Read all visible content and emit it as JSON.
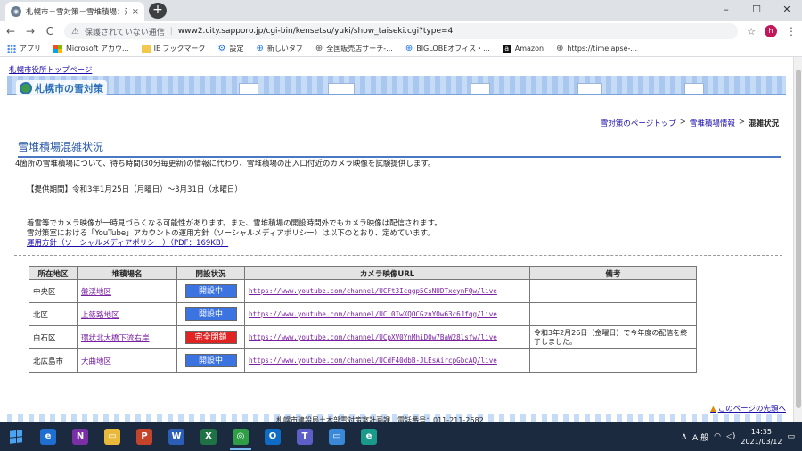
{
  "browser": {
    "tab_title": "札幌市－雪対策－雪堆積場：混雑",
    "tab_close": "×",
    "new_tab": "+",
    "win_minimize": "–",
    "win_maximize": "☐",
    "win_close": "✕",
    "back": "←",
    "forward": "→",
    "reload": "C",
    "security_label": "保護されていない通信",
    "separator": "|",
    "url": "www2.city.sapporo.jp/cgi-bin/kensetsu/yuki/show_taiseki.cgi?type=4",
    "profile_initial": "h"
  },
  "bookmarks": [
    {
      "label": "アプリ",
      "icon": "apps-grid-icon"
    },
    {
      "label": "Microsoft アカウ...",
      "icon": "microsoft-logo-icon"
    },
    {
      "label": "IE ブックマーク",
      "icon": "folder-icon"
    },
    {
      "label": "設定",
      "icon": "gear-icon"
    },
    {
      "label": "新しいタブ",
      "icon": "globe-icon"
    },
    {
      "label": "全国販売店サーチ-...",
      "icon": "globe-icon"
    },
    {
      "label": "BIGLOBEオフィス・...",
      "icon": "globe-icon"
    },
    {
      "label": "Amazon",
      "icon": "amazon-icon"
    },
    {
      "label": "https://timelapse-...",
      "icon": "globe-icon"
    }
  ],
  "page": {
    "top_link": "札幌市役所トップページ",
    "logo_text": "札幌市の雪対策",
    "breadcrumb": {
      "home": "雪対策のページトップ",
      "parent": "雪堆積場情報",
      "current": "混雑状況",
      "sep": ">"
    },
    "heading": "雪堆積場混雑状況",
    "intro": "4箇所の雪堆積場について、待ち時間(30分毎更新)の情報に代わり、雪堆積場の出入口付近のカメラ映像を試験提供します。",
    "period": "【提供期間】令和3年1月25日（月曜日）～3月31日（水曜日）",
    "note1": "着雪等でカメラ映像が一時見づらくなる可能性があります。また、雪堆積場の開設時間外でもカメラ映像は配信されます。",
    "note2": "雪対策室における「YouTube」アカウントの運用方針（ソーシャルメディアポリシー）は以下のとおり、定めています。",
    "policy_link": "運用方針（ソーシャルメディアポリシー）（PDF：169KB）",
    "page_top": "このページの先頭へ",
    "footer": "札幌市建設局土木部雪対策室計画課　電話番号：011-211-2682"
  },
  "table": {
    "headers": [
      "所在地区",
      "堆積場名",
      "開設状況",
      "カメラ映像URL",
      "備考"
    ],
    "rows": [
      {
        "district": "中央区",
        "site": "盤渓地区",
        "status": "開設中",
        "status_kind": "open",
        "url": "https://www.youtube.com/channel/UCFt3Icqgp5CsNUDTxeynFQw/live",
        "remark": ""
      },
      {
        "district": "北区",
        "site": "上篠路地区",
        "status": "開設中",
        "status_kind": "open",
        "url": "https://www.youtube.com/channel/UC_0IwXQOCGznYOw63c6Jfqg/live",
        "remark": ""
      },
      {
        "district": "白石区",
        "site": "環状北大橋下流右岸",
        "status": "完全閉鎖",
        "status_kind": "closed",
        "url": "https://www.youtube.com/channel/UCpXV0YnMhiD0w7BaW28lsfw/live",
        "remark": "令和3年2月26日（金曜日）で今年度の配信を終了しました。"
      },
      {
        "district": "北広島市",
        "site": "大曲地区",
        "status": "開設中",
        "status_kind": "open",
        "url": "https://www.youtube.com/channel/UCdF40dbB-JLEsAircpGbcAQ/live",
        "remark": ""
      }
    ]
  },
  "colors": {
    "status_open": "#3b74e0",
    "status_closed": "#e02424",
    "heading": "#2b5aa8"
  },
  "taskbar": {
    "apps": [
      {
        "name": "edge-legacy",
        "label": "e",
        "color": "#1e6fd1"
      },
      {
        "name": "onenote",
        "label": "N",
        "color": "#7b2fa6"
      },
      {
        "name": "explorer",
        "label": "▭",
        "color": "#e8b93a"
      },
      {
        "name": "powerpoint",
        "label": "P",
        "color": "#c4432b"
      },
      {
        "name": "word",
        "label": "W",
        "color": "#2b5eb7"
      },
      {
        "name": "excel",
        "label": "X",
        "color": "#1f7244"
      },
      {
        "name": "chrome",
        "label": "◎",
        "color": "#2f9e47"
      },
      {
        "name": "outlook",
        "label": "O",
        "color": "#0e6cc4"
      },
      {
        "name": "teams",
        "label": "T",
        "color": "#5b5fc7"
      },
      {
        "name": "onedrive-folder",
        "label": "▭",
        "color": "#3a88d8"
      },
      {
        "name": "edge",
        "label": "e",
        "color": "#1a9a8a"
      }
    ],
    "ime": "A 般",
    "time": "14:35",
    "date": "2021/03/12"
  }
}
